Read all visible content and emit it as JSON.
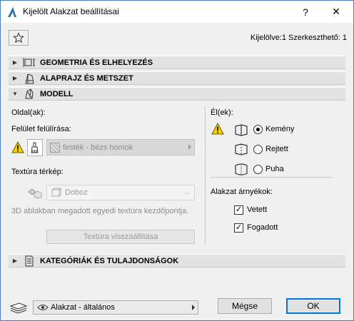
{
  "window": {
    "title": "Kijelölt Alakzat beállításai",
    "help_label": "?",
    "close_label": "✕"
  },
  "header": {
    "selection_info": "Kijelölve:1 Szerkeszthető: 1"
  },
  "sections": {
    "geometry": "GEOMETRIA ÉS ELHELYEZÉS",
    "plan": "ALAPRAJZ ÉS METSZET",
    "model": "MODELL",
    "categories": "KATEGÓRIÁK ÉS TULAJDONSÁGOK"
  },
  "model": {
    "sides_label": "Oldal(ak):",
    "surface_override_label": "Felület felülírása:",
    "surface_value": "festék - bézs homok",
    "texture_map_label": "Textúra térkép:",
    "texture_value": "Doboz",
    "note": "3D ablakban megadott egyedi textúra kezdőpontja.",
    "reset_label": "Textúra visszaállítása",
    "edges_label": "Él(ek):",
    "edge_options": [
      "Kemény",
      "Rejtett",
      "Puha"
    ],
    "edge_selected": "Kemény",
    "shadows_label": "Alakzat árnyékok:",
    "shadow_cast": "Vetett",
    "shadow_received": "Fogadott"
  },
  "footer": {
    "favorite_label": "Alakzat - általános",
    "cancel_label": "Mégse",
    "ok_label": "OK"
  }
}
